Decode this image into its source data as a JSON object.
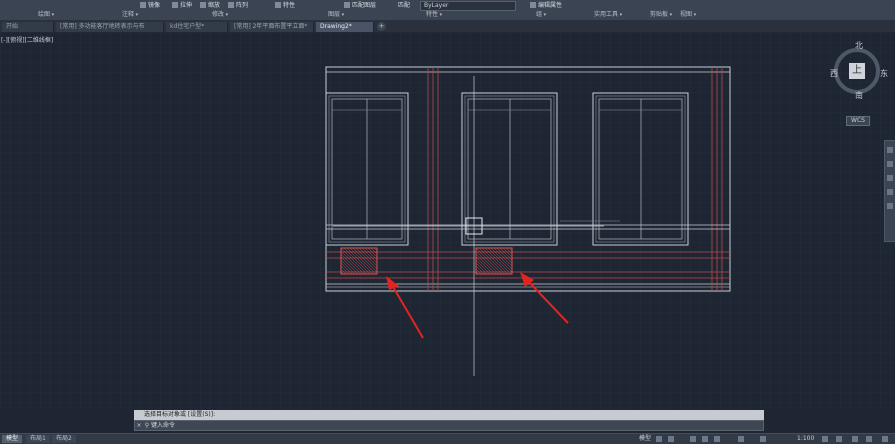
{
  "ribbon": {
    "panels": [
      {
        "label": "绘图"
      },
      {
        "label": "注释"
      },
      {
        "label": "修改"
      },
      {
        "label": "图层"
      },
      {
        "label": "特性"
      },
      {
        "label": "组"
      },
      {
        "label": "实用工具"
      },
      {
        "label": "剪贴板"
      },
      {
        "label": "视图"
      }
    ],
    "tools": {
      "mirror": "镜像",
      "stretch": "拉伸",
      "scale": "缩放",
      "array": "阵列",
      "properties": "特性",
      "layer_state": "匹配图层",
      "match": "匹配",
      "bylayer": "ByLayer",
      "edit_attr": "编辑属性"
    }
  },
  "tabs": [
    {
      "label": "开始"
    },
    {
      "label": "[常用] 多功能客厅地砖表示与布"
    },
    {
      "label": "kd住宅户型*"
    },
    {
      "label": "[常用] 2年平面布置平立面*"
    },
    {
      "label": "Drawing2*",
      "active": true
    }
  ],
  "viewport_label": "[-][俯视][二维线框]",
  "compass": {
    "north": "北",
    "south": "南",
    "east": "东",
    "west": "西",
    "top": "上",
    "wcs": "WCS"
  },
  "command": {
    "history": "选择目标对象或 [设置(S)]:",
    "prompt": "键入命令"
  },
  "layout_tabs": [
    {
      "label": "模型",
      "active": true
    },
    {
      "label": "布局1"
    },
    {
      "label": "布局2"
    }
  ],
  "status": {
    "model": "模型",
    "scale": "1:100"
  }
}
